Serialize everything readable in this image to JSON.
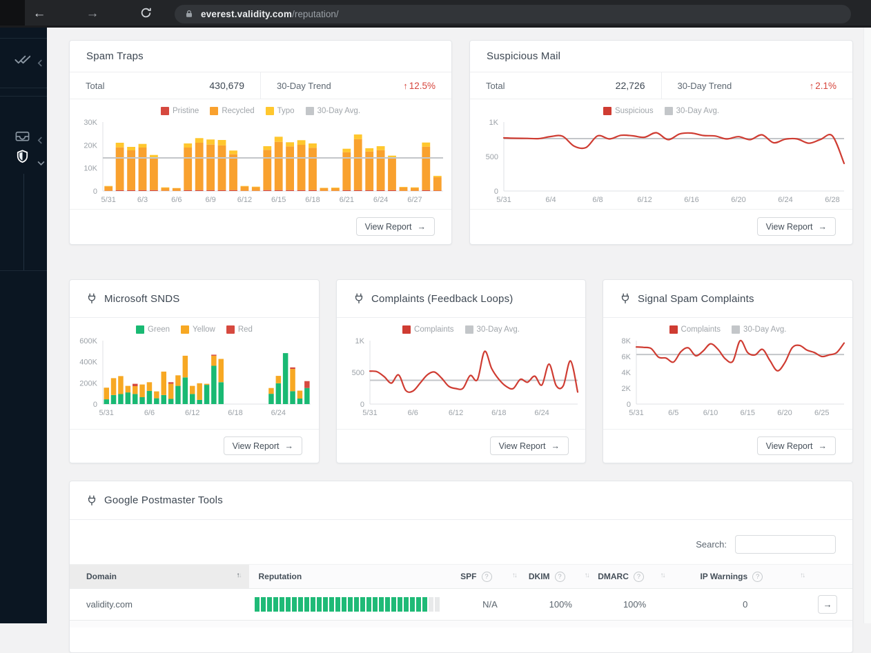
{
  "browser": {
    "url_host": "everest.validity.com",
    "url_path": "/reputation/"
  },
  "glyphs": {
    "up": "↑",
    "down": "↓",
    "help": "?",
    "right_arrow": "→",
    "back": "←",
    "forward": "→"
  },
  "common": {
    "total_label": "Total",
    "trend_label": "30-Day Trend",
    "view_report": "View Report"
  },
  "sidebar": {
    "items": [
      {
        "icon": "double-check-icon",
        "chevron": "left"
      },
      {
        "icon": "inbox-icon",
        "chevron": "left"
      },
      {
        "icon": "shield-icon",
        "chevron": "down",
        "active": true
      }
    ]
  },
  "cards": {
    "spam_traps": {
      "title": "Spam Traps",
      "total": "430,679",
      "trend": "12.5%",
      "chart_data": {
        "type": "stacked_bar",
        "ylim": [
          0,
          30000
        ],
        "grid": false,
        "legend_position": "top",
        "categories": [
          "5/31",
          "6/1",
          "6/2",
          "6/3",
          "6/4",
          "6/5",
          "6/6",
          "6/7",
          "6/8",
          "6/9",
          "6/10",
          "6/11",
          "6/12",
          "6/13",
          "6/14",
          "6/15",
          "6/16",
          "6/17",
          "6/18",
          "6/19",
          "6/20",
          "6/21",
          "6/22",
          "6/23",
          "6/24",
          "6/25",
          "6/26",
          "6/27",
          "6/28",
          "6/29"
        ],
        "y_ticks": [
          {
            "v": 0,
            "label": "0"
          },
          {
            "v": 10000,
            "label": "10K"
          },
          {
            "v": 20000,
            "label": "20K"
          },
          {
            "v": 30000,
            "label": "30K"
          }
        ],
        "x_ticks": [
          {
            "i": 0,
            "label": "5/31"
          },
          {
            "i": 3,
            "label": "6/3"
          },
          {
            "i": 6,
            "label": "6/6"
          },
          {
            "i": 9,
            "label": "6/9"
          },
          {
            "i": 12,
            "label": "6/12"
          },
          {
            "i": 15,
            "label": "6/15"
          },
          {
            "i": 18,
            "label": "6/18"
          },
          {
            "i": 21,
            "label": "6/21"
          },
          {
            "i": 24,
            "label": "6/24"
          },
          {
            "i": 27,
            "label": "6/27"
          }
        ],
        "series": [
          {
            "name": "Pristine",
            "color": "#d6493f",
            "values": [
              100,
              400,
              400,
              400,
              400,
              100,
              100,
              400,
              400,
              400,
              400,
              400,
              100,
              100,
              400,
              400,
              400,
              400,
              400,
              100,
              100,
              400,
              400,
              400,
              400,
              400,
              100,
              100,
              400,
              200
            ]
          },
          {
            "name": "Recycled",
            "color": "#f9a12e",
            "values": [
              1900,
              18600,
              17300,
              18500,
              14100,
              1300,
              1100,
              18500,
              20600,
              19800,
              19500,
              15600,
              1900,
              1600,
              17500,
              21000,
              19000,
              19700,
              18400,
              1200,
              1200,
              16500,
              22200,
              16800,
              17400,
              13800,
              1500,
              1300,
              18900,
              5900
            ]
          },
          {
            "name": "Typo",
            "color": "#ffc72e",
            "values": [
              200,
              2000,
              1500,
              1600,
              1200,
              200,
              100,
              1800,
              2000,
              2200,
              2300,
              1600,
              200,
              200,
              1600,
              2200,
              1800,
              2000,
              1900,
              100,
              200,
              1500,
              2000,
              1400,
              1700,
              1200,
              200,
              200,
              1800,
              500
            ]
          }
        ],
        "avg": {
          "label": "30-Day Avg.",
          "color": "#c3c6c9",
          "value": 14400
        }
      }
    },
    "suspicious_mail": {
      "title": "Suspicious Mail",
      "total": "22,726",
      "trend": "2.1%",
      "chart_data": {
        "type": "line",
        "ylim": [
          0,
          1000
        ],
        "grid": false,
        "legend_position": "top",
        "categories": [
          "5/31",
          "6/1",
          "6/2",
          "6/3",
          "6/4",
          "6/5",
          "6/6",
          "6/7",
          "6/8",
          "6/9",
          "6/10",
          "6/11",
          "6/12",
          "6/13",
          "6/14",
          "6/15",
          "6/16",
          "6/17",
          "6/18",
          "6/19",
          "6/20",
          "6/21",
          "6/22",
          "6/23",
          "6/24",
          "6/25",
          "6/26",
          "6/27",
          "6/28",
          "6/29"
        ],
        "y_ticks": [
          {
            "v": 0,
            "label": "0"
          },
          {
            "v": 500,
            "label": "500"
          },
          {
            "v": 1000,
            "label": "1K"
          }
        ],
        "x_ticks": [
          {
            "i": 0,
            "label": "5/31"
          },
          {
            "i": 4,
            "label": "6/4"
          },
          {
            "i": 8,
            "label": "6/8"
          },
          {
            "i": 12,
            "label": "6/12"
          },
          {
            "i": 16,
            "label": "6/16"
          },
          {
            "i": 20,
            "label": "6/20"
          },
          {
            "i": 24,
            "label": "6/24"
          },
          {
            "i": 28,
            "label": "6/28"
          }
        ],
        "series": [
          {
            "name": "Suspicious",
            "color": "#cf3c32",
            "values": [
              770,
              765,
              763,
              760,
              790,
              795,
              650,
              630,
              800,
              755,
              808,
              800,
              780,
              845,
              745,
              828,
              840,
              805,
              798,
              755,
              788,
              745,
              815,
              700,
              752,
              755,
              693,
              748,
              800,
              400
            ]
          }
        ],
        "avg": {
          "label": "30-Day Avg.",
          "color": "#c3c6c9",
          "value": 760
        }
      }
    },
    "microsoft_snds": {
      "title": "Microsoft SNDS",
      "chart_data": {
        "type": "stacked_bar",
        "ylim": [
          0,
          600000
        ],
        "grid": false,
        "legend_position": "top",
        "categories": [
          "5/31",
          "6/1",
          "6/2",
          "6/3",
          "6/4",
          "6/5",
          "6/6",
          "6/7",
          "6/8",
          "6/9",
          "6/10",
          "6/11",
          "6/12",
          "6/13",
          "6/14",
          "6/15",
          "6/16",
          "6/17",
          "6/18",
          "6/19",
          "6/20",
          "6/21",
          "6/22",
          "6/23",
          "6/24",
          "6/25",
          "6/26",
          "6/27",
          "6/28"
        ],
        "y_ticks": [
          {
            "v": 0,
            "label": "0"
          },
          {
            "v": 200000,
            "label": "200K"
          },
          {
            "v": 400000,
            "label": "400K"
          },
          {
            "v": 600000,
            "label": "600K"
          }
        ],
        "x_ticks": [
          {
            "i": 0,
            "label": "5/31"
          },
          {
            "i": 6,
            "label": "6/6"
          },
          {
            "i": 12,
            "label": "6/12"
          },
          {
            "i": 18,
            "label": "6/18"
          },
          {
            "i": 24,
            "label": "6/24"
          }
        ],
        "series": [
          {
            "name": "Green",
            "color": "#19b973",
            "values": [
              45000,
              85000,
              95000,
              110000,
              95000,
              65000,
              125000,
              55000,
              85000,
              50000,
              172000,
              252000,
              95000,
              40000,
              182000,
              362000,
              207000,
              0,
              0,
              0,
              0,
              0,
              0,
              97000,
              197000,
              482000,
              122000,
              52000,
              152000
            ]
          },
          {
            "name": "Yellow",
            "color": "#f7a823",
            "values": [
              110000,
              160000,
              170000,
              62000,
              75000,
              120000,
              82000,
              65000,
              222000,
              142000,
              100000,
              205000,
              77000,
              157000,
              10000,
              95000,
              220000,
              0,
              0,
              0,
              0,
              0,
              0,
              55000,
              70000,
              0,
              210000,
              75000,
              0
            ]
          },
          {
            "name": "Red",
            "color": "#d6493f",
            "values": [
              0,
              0,
              0,
              0,
              22000,
              0,
              0,
              0,
              0,
              15000,
              0,
              0,
              0,
              0,
              0,
              10000,
              0,
              0,
              0,
              0,
              0,
              0,
              0,
              0,
              0,
              0,
              15000,
              0,
              65000
            ]
          }
        ]
      }
    },
    "complaints": {
      "title": "Complaints (Feedback Loops)",
      "chart_data": {
        "type": "line",
        "ylim": [
          0,
          1000
        ],
        "grid": false,
        "legend_position": "top",
        "categories": [
          "5/31",
          "6/1",
          "6/2",
          "6/3",
          "6/4",
          "6/5",
          "6/6",
          "6/7",
          "6/8",
          "6/9",
          "6/10",
          "6/11",
          "6/12",
          "6/13",
          "6/14",
          "6/15",
          "6/16",
          "6/17",
          "6/18",
          "6/19",
          "6/20",
          "6/21",
          "6/22",
          "6/23",
          "6/24",
          "6/25",
          "6/26",
          "6/27",
          "6/28",
          "6/29"
        ],
        "y_ticks": [
          {
            "v": 0,
            "label": "0"
          },
          {
            "v": 500,
            "label": "500"
          },
          {
            "v": 1000,
            "label": "1K"
          }
        ],
        "x_ticks": [
          {
            "i": 0,
            "label": "5/31"
          },
          {
            "i": 6,
            "label": "6/6"
          },
          {
            "i": 12,
            "label": "6/12"
          },
          {
            "i": 18,
            "label": "6/18"
          },
          {
            "i": 24,
            "label": "6/24"
          }
        ],
        "series": [
          {
            "name": "Complaints",
            "color": "#cf3c32",
            "values": [
              520,
              510,
              430,
              330,
              460,
              215,
              205,
              330,
              460,
              505,
              410,
              280,
              245,
              250,
              450,
              385,
              830,
              560,
              390,
              280,
              245,
              390,
              345,
              440,
              300,
              630,
              290,
              290,
              680,
              190
            ]
          }
        ],
        "avg": {
          "label": "30-Day Avg.",
          "color": "#c3c6c9",
          "value": 375
        }
      }
    },
    "signal_spam": {
      "title": "Signal Spam Complaints",
      "chart_data": {
        "type": "line",
        "ylim": [
          0,
          8000
        ],
        "grid": false,
        "legend_position": "top",
        "categories": [
          "5/31",
          "6/1",
          "6/2",
          "6/3",
          "6/4",
          "6/5",
          "6/6",
          "6/7",
          "6/8",
          "6/9",
          "6/10",
          "6/11",
          "6/12",
          "6/13",
          "6/14",
          "6/15",
          "6/16",
          "6/17",
          "6/18",
          "6/19",
          "6/20",
          "6/21",
          "6/22",
          "6/23",
          "6/24",
          "6/25",
          "6/26",
          "6/27",
          "6/28"
        ],
        "y_ticks": [
          {
            "v": 0,
            "label": "0"
          },
          {
            "v": 2000,
            "label": "2K"
          },
          {
            "v": 4000,
            "label": "4K"
          },
          {
            "v": 6000,
            "label": "6K"
          },
          {
            "v": 8000,
            "label": "8K"
          }
        ],
        "x_ticks": [
          {
            "i": 0,
            "label": "5/31"
          },
          {
            "i": 5,
            "label": "6/5"
          },
          {
            "i": 10,
            "label": "6/10"
          },
          {
            "i": 15,
            "label": "6/15"
          },
          {
            "i": 20,
            "label": "6/20"
          },
          {
            "i": 25,
            "label": "6/25"
          }
        ],
        "series": [
          {
            "name": "Complaints",
            "color": "#cf3c32",
            "values": [
              7200,
              7150,
              7000,
              5900,
              5800,
              5300,
              6600,
              7100,
              6100,
              6700,
              7600,
              6900,
              5700,
              5400,
              8000,
              6500,
              6200,
              6900,
              5500,
              4200,
              5200,
              7100,
              7400,
              6800,
              6500,
              6000,
              6200,
              6500,
              7700
            ]
          }
        ],
        "avg": {
          "label": "30-Day Avg.",
          "color": "#c3c6c9",
          "value": 6250
        }
      }
    },
    "google_postmaster": {
      "title": "Google Postmaster Tools",
      "search_label": "Search:",
      "search_value": "",
      "table": {
        "columns": [
          {
            "label": "Domain",
            "sorted": "asc"
          },
          {
            "label": "Reputation"
          },
          {
            "label": "SPF",
            "help": true
          },
          {
            "label": "DKIM",
            "help": true
          },
          {
            "label": "DMARC",
            "help": true
          },
          {
            "label": "IP Warnings",
            "help": true
          }
        ],
        "row": {
          "domain": "validity.com",
          "reputation": {
            "segments": 30,
            "filled": 28,
            "filled_color": "#1fba77",
            "empty_color": "#e8e9ea"
          },
          "spf": "N/A",
          "dkim": "100%",
          "dmarc": "100%",
          "ip_warnings": "0"
        }
      }
    }
  }
}
